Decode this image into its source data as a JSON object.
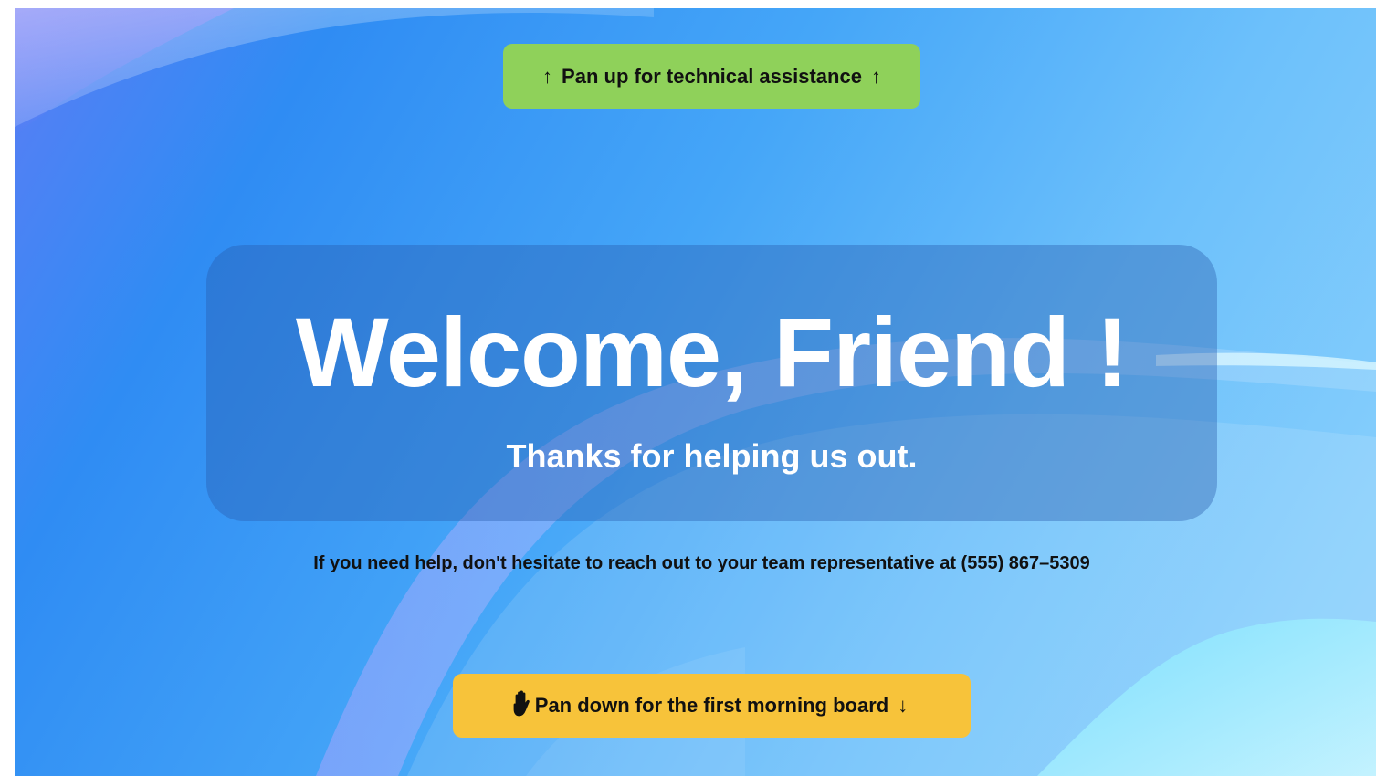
{
  "buttons": {
    "pan_up": {
      "label": "Pan up for technical assistance",
      "arrow_left": "↑",
      "arrow_right": "↑"
    },
    "pan_down": {
      "label": "Pan down for the first morning board",
      "arrow_left": "↓",
      "arrow_right": "↓"
    }
  },
  "welcome": {
    "title": "Welcome, Friend !",
    "subtitle": "Thanks for helping us out."
  },
  "help": {
    "text": "If you need help, don't hesitate to reach out to your team representative at (555) 867–5309"
  },
  "colors": {
    "pan_up_bg": "#8fd15a",
    "pan_down_bg": "#f7c33a",
    "background_primary": "#2f8cf3",
    "background_secondary": "#8fd3fc"
  },
  "icons": {
    "cursor": "hand-grab-cursor-icon"
  }
}
